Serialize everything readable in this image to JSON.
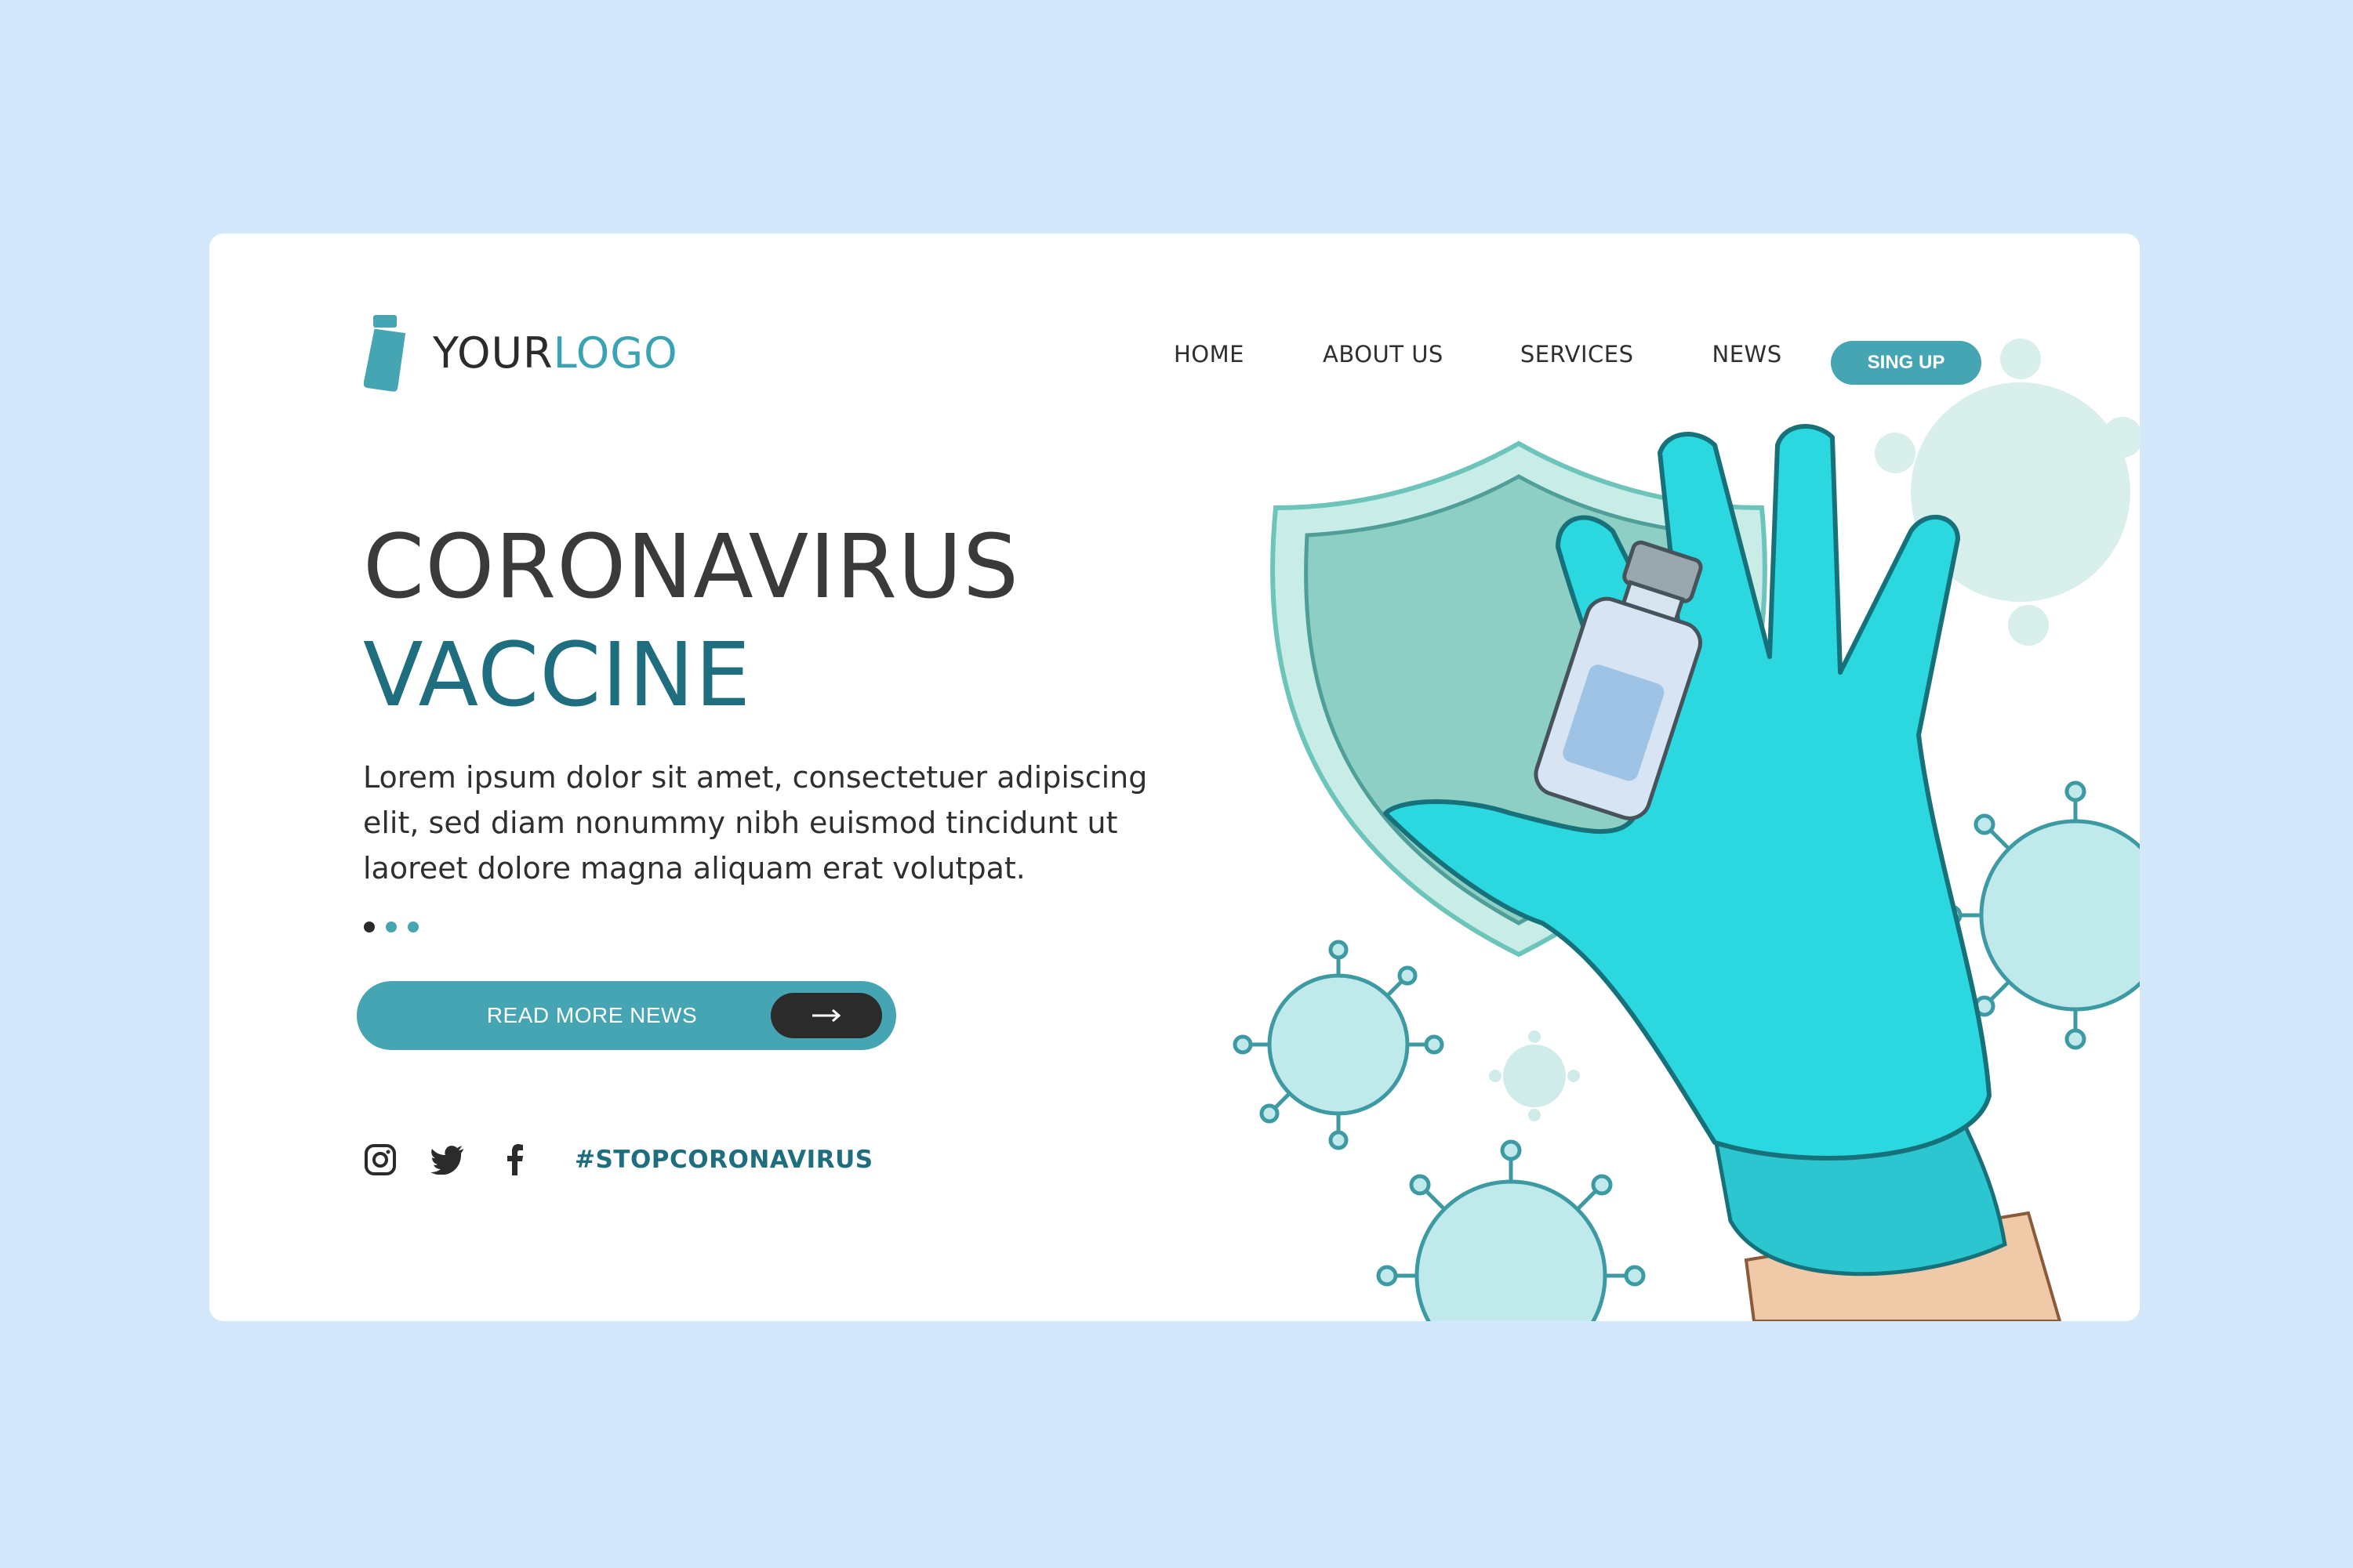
{
  "logo": {
    "text_your": "YOUR",
    "text_logo": "LOGO"
  },
  "nav": {
    "items": [
      {
        "label": "HOME"
      },
      {
        "label": "ABOUT US"
      },
      {
        "label": "SERVICES"
      },
      {
        "label": "NEWS"
      }
    ],
    "signup_label": "SING UP"
  },
  "hero": {
    "title_line1": "CORONAVIRUS",
    "title_line2": "VACCINE",
    "paragraph": "Lorem ipsum dolor sit amet, consectetuer adipiscing elit, sed diam nonummy nibh euismod tincidunt ut laoreet dolore magna aliquam erat volutpat.",
    "read_more_label": "READ MORE NEWS"
  },
  "social": {
    "hashtag": "#STOPCORONAVIRUS"
  },
  "icons": [
    "vial-icon",
    "arrow-right-icon",
    "instagram-icon",
    "twitter-icon",
    "facebook-icon"
  ],
  "colors": {
    "background": "#d4e8fb",
    "accent": "#46a5b3",
    "title_dark": "#3a3a3a",
    "title_teal": "#1f6e7f",
    "glove": "#2bd4dc",
    "shield": "#8dcfc4"
  }
}
